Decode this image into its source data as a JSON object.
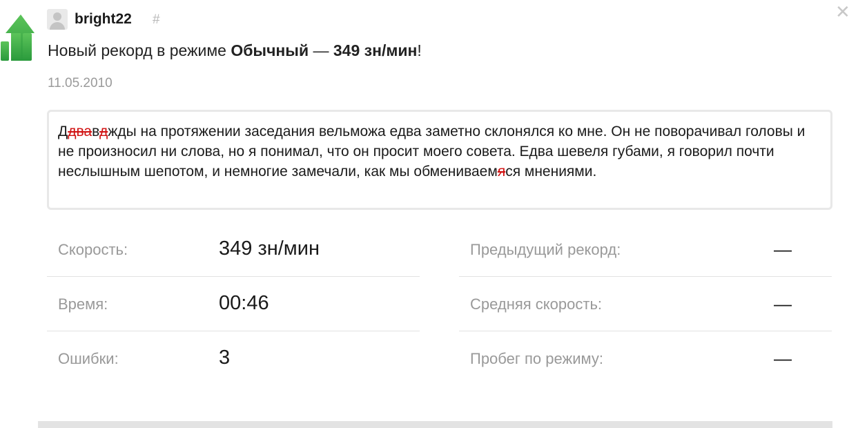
{
  "header": {
    "username": "bright22",
    "hash": "#",
    "close": "✕"
  },
  "headline": {
    "prefix": "Новый рекорд в режиме ",
    "mode": "Обычный",
    "dash": " — ",
    "speed": "349 зн/мин",
    "suffix": "!"
  },
  "date": "11.05.2010",
  "text": {
    "s1": "Д",
    "e1": "два",
    "s2": "в",
    "e2": "д",
    "s3": "жды на протяжении заседания вельможа едва заметно склонялся ко мне. Он не поворачивал головы и не произносил ни слова, но я понимал, что он просит моего совета. Едва шевеля губами, я говорил почти неслышным шепотом, и немногие замечали, как мы обмениваем",
    "e3": "я",
    "s4": "ся мнениями."
  },
  "stats_left": [
    {
      "label": "Скорость:",
      "value": "349 зн/мин"
    },
    {
      "label": "Время:",
      "value": "00:46"
    },
    {
      "label": "Ошибки:",
      "value": "3"
    }
  ],
  "stats_right": [
    {
      "label": "Предыдущий рекорд:",
      "value": "—"
    },
    {
      "label": "Средняя скорость:",
      "value": "—"
    },
    {
      "label": "Пробег по режиму:",
      "value": "—"
    }
  ],
  "colors": {
    "arrow_green": "#2aa642",
    "error_red": "#d01010"
  },
  "icons": {
    "record": "green-up-arrow-chart-icon",
    "avatar": "user-placeholder-icon",
    "close": "close-icon"
  }
}
